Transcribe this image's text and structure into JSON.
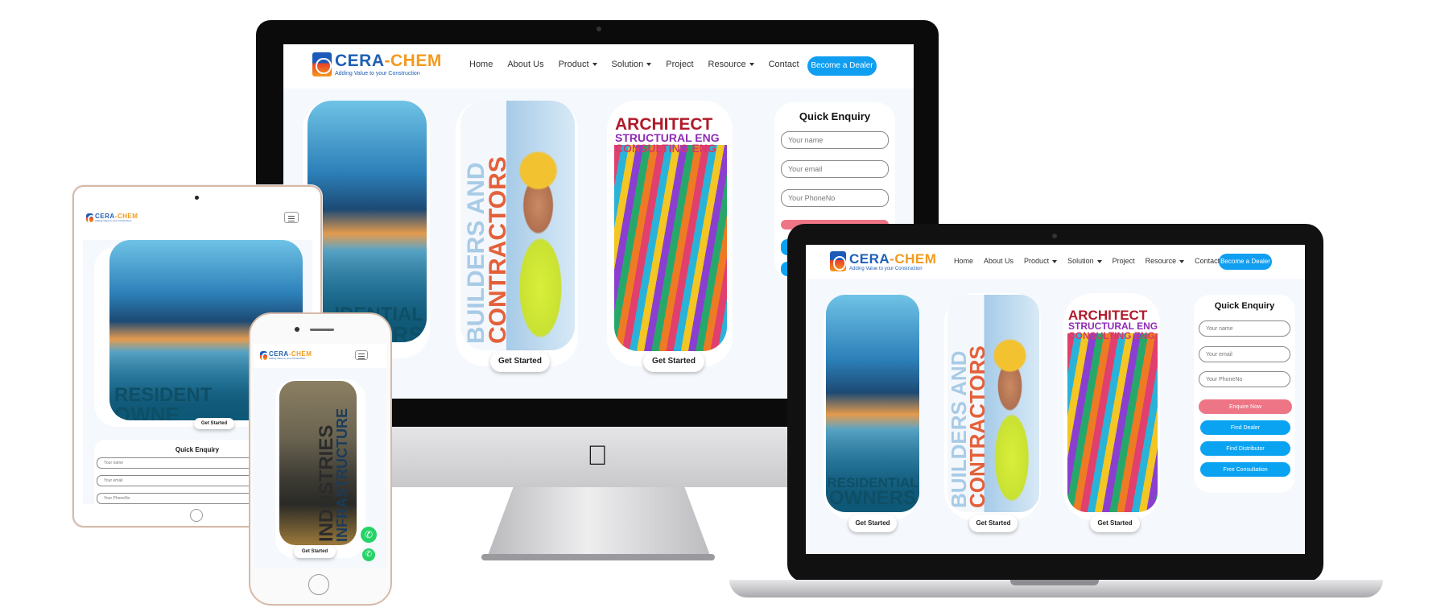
{
  "brand": {
    "name_part1": "CERA",
    "name_dash": "-",
    "name_part2": "CHEM",
    "tagline": "Adding Value to your Construction"
  },
  "nav": {
    "items": [
      "Home",
      "About Us",
      "Product",
      "Solution",
      "Project",
      "Resource",
      "Contact"
    ],
    "dropdown_items": [
      "Product",
      "Solution",
      "Resource"
    ],
    "cta": "Become a Dealer"
  },
  "cards": {
    "residential": {
      "line1": "RESIDENTIAL",
      "line2": "OWNERS",
      "button": "Get Started"
    },
    "builders": {
      "line1": "BUILDERS AND",
      "line2": "CONTRACTORS",
      "button": "Get Started"
    },
    "architect": {
      "line1": "ARCHITECT",
      "line2": "STRUCTURAL ENG",
      "line3": "CONSULTING ENG",
      "button": "Get Started"
    },
    "industries": {
      "line1": "INDUSTRIES",
      "line2": "INFRASTRUCTURE",
      "button": "Get Started"
    }
  },
  "imac_partial": {
    "residential_line1": "IDENTIAL",
    "residential_line2": "ERS"
  },
  "ipad_partial": {
    "line1": "RESIDENT",
    "line2": "OWNE"
  },
  "enquiry": {
    "title": "Quick Enquiry",
    "name_placeholder": "Your name",
    "email_placeholder": "Your email",
    "phone_placeholder": "Your PhoneNo",
    "ipad_phone_placeholder": "Your PhoneNo",
    "submit": "Enquire Now",
    "find_dealer": "Find Dealer",
    "find_distributor": "Find Distributor",
    "free_consultation": "Free Consultation"
  },
  "colors": {
    "brand_blue": "#1f5fb5",
    "brand_orange": "#f39a1e",
    "accent_blue": "#109ef1",
    "enquire_pink": "#ee7585",
    "whatsapp_green": "#25d366"
  },
  "icons": {
    "logo": "cera-chem-logo",
    "apple": "apple-logo-icon",
    "menu": "hamburger-icon",
    "whatsapp": "whatsapp-icon"
  }
}
